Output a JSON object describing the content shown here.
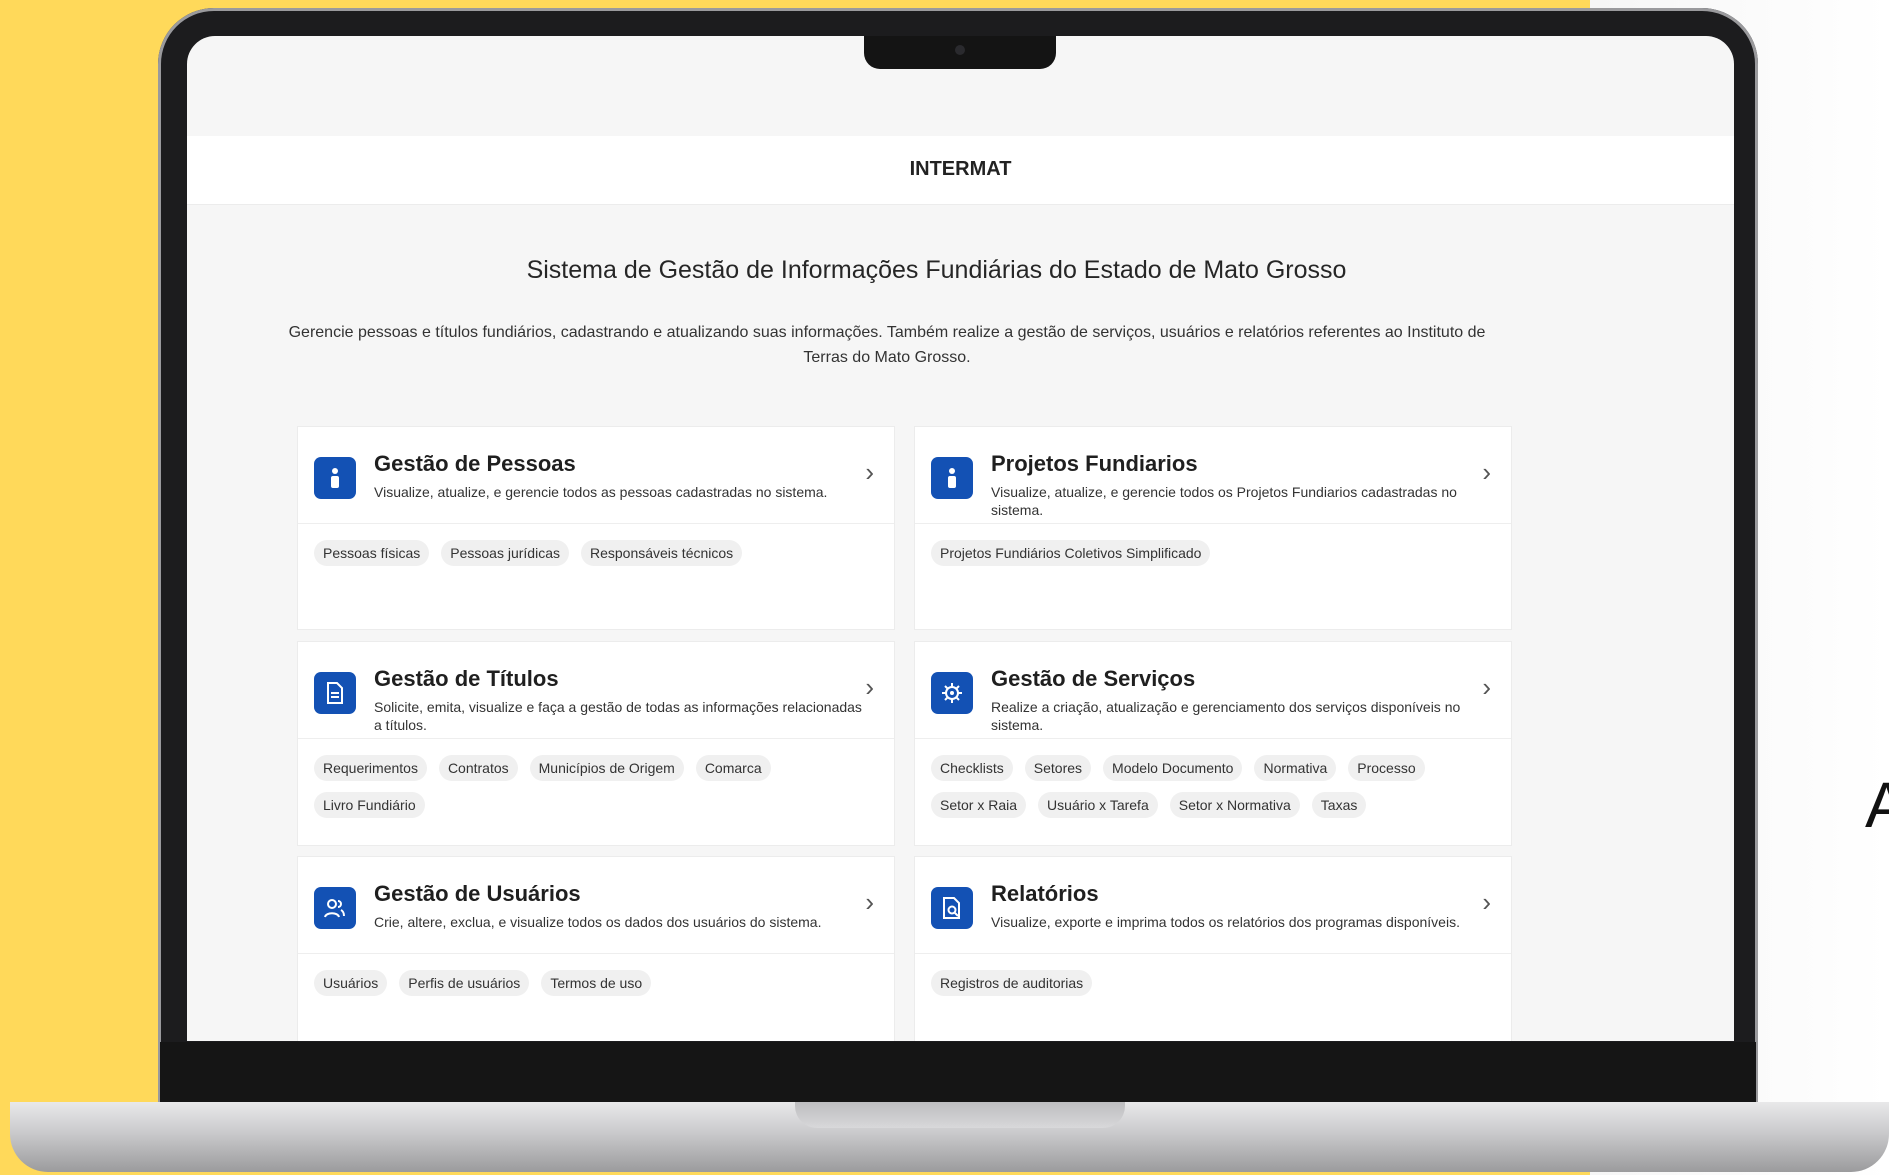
{
  "header": {
    "title": "INTERMAT"
  },
  "intro": {
    "title": "Sistema de Gestão de Informações Fundiárias do Estado de Mato Grosso",
    "description": "Gerencie pessoas e títulos fundiários, cadastrando e atualizando suas informações. Também realize a gestão de serviços, usuários e relatórios referentes ao Instituto de Terras do Mato Grosso."
  },
  "cards": [
    {
      "title": "Gestão de Pessoas",
      "description": "Visualize, atualize, e gerencie todos as pessoas cadastradas no sistema.",
      "icon": "person-icon",
      "tags": [
        "Pessoas físicas",
        "Pessoas jurídicas",
        "Responsáveis técnicos"
      ]
    },
    {
      "title": "Projetos Fundiarios",
      "description": "Visualize, atualize, e gerencie todos os Projetos Fundiarios cadastradas no sistema.",
      "icon": "person-icon",
      "tags": [
        "Projetos Fundiários Coletivos Simplificado"
      ]
    },
    {
      "title": "Gestão de Títulos",
      "description": "Solicite, emita, visualize e faça a gestão de todas as informações relacionadas a títulos.",
      "icon": "document-icon",
      "tags": [
        "Requerimentos",
        "Contratos",
        "Municípios de Origem",
        "Comarca",
        "Livro Fundiário"
      ]
    },
    {
      "title": "Gestão de Serviços",
      "description": "Realize a criação, atualização e gerenciamento dos serviços disponíveis no sistema.",
      "icon": "gear-icon",
      "tags": [
        "Checklists",
        "Setores",
        "Modelo Documento",
        "Normativa",
        "Processo",
        "Setor x Raia",
        "Usuário x Tarefa",
        "Setor x Normativa",
        "Taxas"
      ]
    },
    {
      "title": "Gestão de Usuários",
      "description": "Crie, altere, exclua, e visualize todos os dados dos usuários do sistema.",
      "icon": "users-icon",
      "tags": [
        "Usuários",
        "Perfis de usuários",
        "Termos de uso"
      ]
    },
    {
      "title": "Relatórios",
      "description": "Visualize, exporte e imprima todos os relatórios dos programas disponíveis.",
      "icon": "report-icon",
      "tags": [
        "Registros de auditorias"
      ]
    }
  ],
  "side_text": "A",
  "colors": {
    "accent": "#1351b4",
    "background": "#FFD95A"
  }
}
